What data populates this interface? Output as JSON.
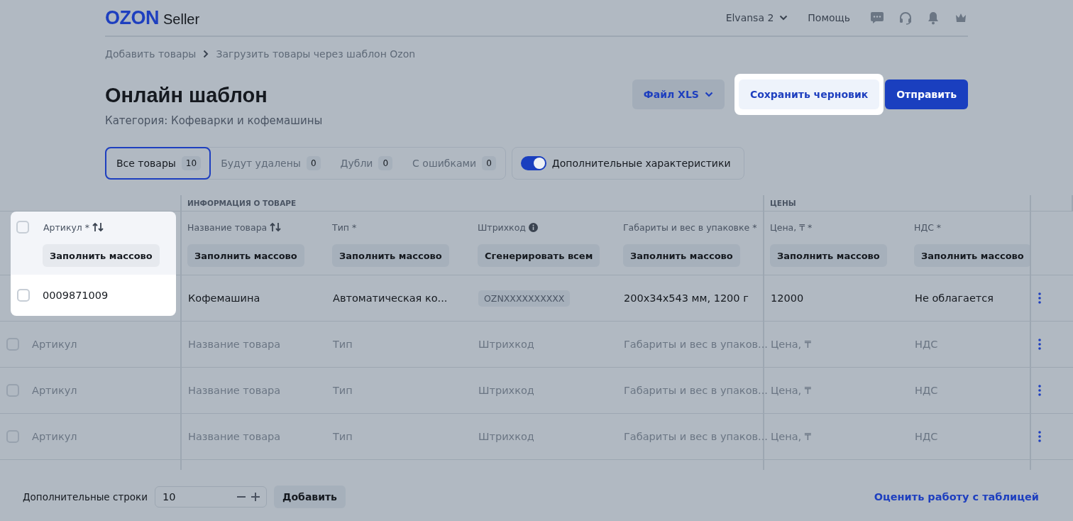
{
  "header": {
    "logo": "OZON",
    "logo_suffix": "Seller",
    "account": "Elvansa 2",
    "help": "Помощь"
  },
  "breadcrumbs": [
    "Добавить товары",
    "Загрузить товары через шаблон Ozon"
  ],
  "title": "Онлайн шаблон",
  "subtitle": "Категория: Кофеварки и кофемашины",
  "actions": [
    {
      "label": "Файл XLS",
      "kind": "dropdown",
      "highlighted": false
    },
    {
      "label": "Сохранить черновик",
      "kind": "secondary",
      "highlighted": true
    },
    {
      "label": "Отправить",
      "kind": "primary",
      "highlighted": false
    }
  ],
  "tabs": [
    {
      "label": "Все товары",
      "count": "10",
      "selected": true
    },
    {
      "label": "Будут удалены",
      "count": "0",
      "selected": false
    },
    {
      "label": "Дубли",
      "count": "0",
      "selected": false
    },
    {
      "label": "С ошибками",
      "count": "0",
      "selected": false
    }
  ],
  "toggle": {
    "label": "Дополнительные характеристики",
    "on": true
  },
  "table": {
    "groups": [
      {
        "columns": [
          {
            "title": "Артикул *",
            "sortable": true,
            "info": false,
            "action": "Заполнить массово",
            "highlighted": true
          }
        ]
      },
      {
        "label": "ИНФОРМАЦИЯ О ТОВАРЕ",
        "columns": [
          {
            "title": "Название товара",
            "sortable": true,
            "info": false,
            "action": "Заполнить массово",
            "highlighted": false
          },
          {
            "title": "Тип *",
            "sortable": false,
            "info": false,
            "action": "Заполнить массово",
            "highlighted": false
          },
          {
            "title": "Штрихкод",
            "sortable": false,
            "info": true,
            "action": "Сгенерировать всем",
            "highlighted": false
          },
          {
            "title": "Габариты и вес в упаковке *",
            "sortable": false,
            "info": false,
            "action": "Заполнить массово",
            "highlighted": false
          }
        ]
      },
      {
        "label": "ЦЕНЫ",
        "columns": [
          {
            "title": "Цена, ₸ *",
            "sortable": false,
            "info": false,
            "action": "Заполнить массово",
            "highlighted": false
          },
          {
            "title": "НДС *",
            "sortable": false,
            "info": false,
            "action": "Заполнить массово",
            "highlighted": false
          }
        ]
      }
    ],
    "rows": [
      {
        "highlighted": true,
        "checked": false,
        "cells": [
          {
            "text": "0009871009",
            "kind": "value"
          },
          {
            "text": "Кофемашина",
            "kind": "value"
          },
          {
            "text": "Автоматическая ко...",
            "kind": "value"
          },
          {
            "text": "OZNXXXXXXXXXX",
            "kind": "tag"
          },
          {
            "text": "200x34x543 мм, 1200 г",
            "kind": "value"
          },
          {
            "text": "12000",
            "kind": "value"
          },
          {
            "text": "Не облагается",
            "kind": "value"
          }
        ]
      },
      {
        "highlighted": false,
        "checked": false,
        "cells": [
          {
            "text": "Артикул",
            "kind": "placeholder"
          },
          {
            "text": "Название товара",
            "kind": "placeholder"
          },
          {
            "text": "Тип",
            "kind": "placeholder"
          },
          {
            "text": "Штрихкод",
            "kind": "placeholder"
          },
          {
            "text": "Габариты и вес в упаков...",
            "kind": "placeholder"
          },
          {
            "text": "Цена, ₸",
            "kind": "placeholder"
          },
          {
            "text": "НДС",
            "kind": "placeholder"
          }
        ]
      },
      {
        "highlighted": false,
        "checked": false,
        "cells": [
          {
            "text": "Артикул",
            "kind": "placeholder"
          },
          {
            "text": "Название товара",
            "kind": "placeholder"
          },
          {
            "text": "Тип",
            "kind": "placeholder"
          },
          {
            "text": "Штрихкод",
            "kind": "placeholder"
          },
          {
            "text": "Габариты и вес в упаков...",
            "kind": "placeholder"
          },
          {
            "text": "Цена, ₸",
            "kind": "placeholder"
          },
          {
            "text": "НДС",
            "kind": "placeholder"
          }
        ]
      },
      {
        "highlighted": false,
        "checked": false,
        "cells": [
          {
            "text": "Артикул",
            "kind": "placeholder"
          },
          {
            "text": "Название товара",
            "kind": "placeholder"
          },
          {
            "text": "Тип",
            "kind": "placeholder"
          },
          {
            "text": "Штрихкод",
            "kind": "placeholder"
          },
          {
            "text": "Габариты и вес в упаков...",
            "kind": "placeholder"
          },
          {
            "text": "Цена, ₸",
            "kind": "placeholder"
          },
          {
            "text": "НДС",
            "kind": "placeholder"
          }
        ]
      }
    ]
  },
  "footer": {
    "label": "Дополнительные строки",
    "value": "10",
    "add": "Добавить",
    "link": "Оценить работу с таблицей"
  }
}
